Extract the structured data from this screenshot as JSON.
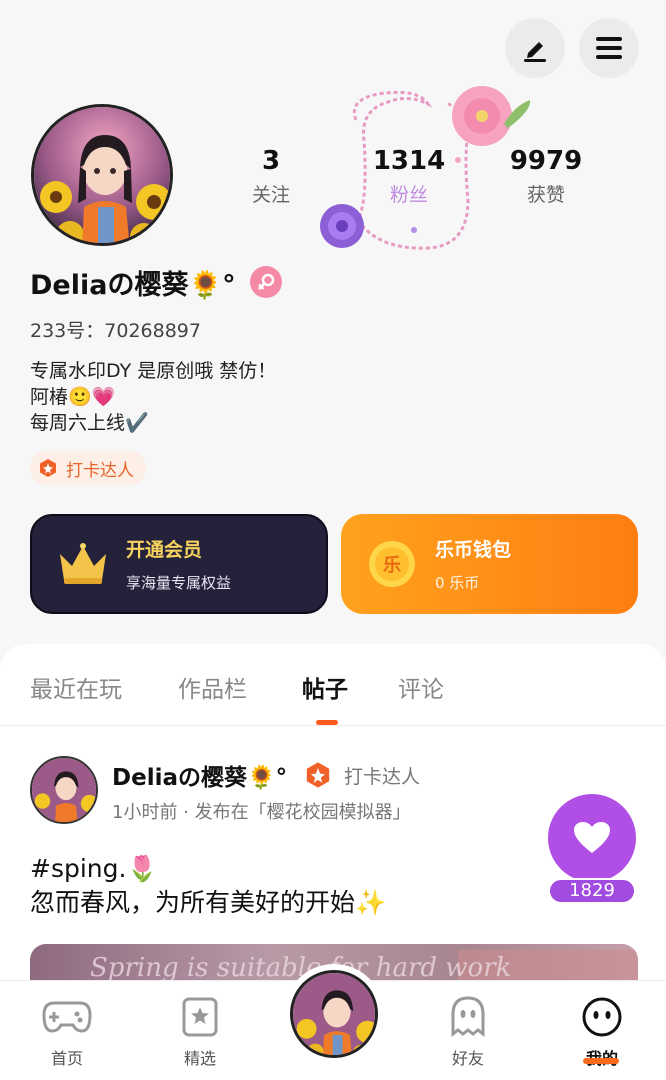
{
  "profile": {
    "username": "Deliaの樱葵🌻°",
    "uid_label": "233号：",
    "uid": "70268897",
    "bio_lines": [
      "专属水印DY 是原创哦 禁仿！",
      "阿椿🙂💗",
      "每周六上线✔️"
    ],
    "badge": "打卡达人",
    "gender": "female"
  },
  "stats": {
    "following": {
      "value": "3",
      "label": "关注"
    },
    "fans": {
      "value": "1314",
      "label": "粉丝"
    },
    "likes": {
      "value": "9979",
      "label": "获赞"
    }
  },
  "cards": {
    "vip": {
      "title": "开通会员",
      "subtitle": "享海量专属权益"
    },
    "wallet": {
      "title": "乐币钱包",
      "subtitle": "0 乐币",
      "icon_text": "乐"
    }
  },
  "tabs": [
    "最近在玩",
    "作品栏",
    "帖子",
    "评论"
  ],
  "active_tab": "帖子",
  "post": {
    "author": "Deliaの樱葵🌻°",
    "badge": "打卡达人",
    "meta": "1小时前 · 发布在「樱花校园模拟器」",
    "text_lines": [
      "#sping.🌷",
      "忽而春风，为所有美好的开始✨"
    ],
    "image_caption": "Spring is suitable for hard work",
    "like_count": "1829"
  },
  "nav": {
    "home": "首页",
    "featured": "精选",
    "friends": "好友",
    "mine": "我的"
  },
  "colors": {
    "accent_orange": "#ff6b1a",
    "vip_card": "#24213a",
    "wallet_card": "#ff8a17",
    "like_purple": "#b04ee6",
    "fans_label": "#c08be0"
  }
}
